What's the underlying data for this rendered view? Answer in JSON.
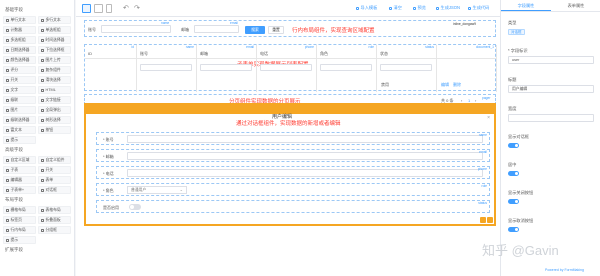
{
  "palette": {
    "basic_title": "基础字段",
    "basic": [
      [
        "单行文本",
        "多行文本"
      ],
      [
        "计数器",
        "单选框组"
      ],
      [
        "多选框组",
        "时间选择器"
      ],
      [
        "日期选择器",
        "下拉选择框"
      ],
      [
        "颜色选择器",
        "图片上传"
      ],
      [
        "评分",
        "复杂组件"
      ],
      [
        "开关",
        "滑块选择"
      ],
      [
        "文字",
        "HTML"
      ],
      [
        "级联",
        "文字链接"
      ],
      [
        "图片",
        "全局弹出"
      ],
      [
        "级联选择器",
        "树形选择"
      ],
      [
        "富文本",
        "按钮"
      ],
      [
        "提示"
      ]
    ],
    "advanced_title": "高级字段",
    "advanced": [
      [
        "自定义区域",
        "自定义组件"
      ],
      [
        "子表",
        "开关"
      ],
      [
        "编辑器",
        "表单"
      ],
      [
        "子表单+",
        "对话框"
      ]
    ],
    "layout_title": "布局字段",
    "layout": [
      [
        "栅格布局",
        "表格布局"
      ],
      [
        "标签页",
        "折叠面板"
      ],
      [
        "行内布局",
        "分组框"
      ],
      [
        "提示"
      ]
    ],
    "bottom_title": "扩展字段"
  },
  "toolbar": {
    "actions": [
      "导入模板",
      "清空",
      "预览",
      "生成JSON",
      "生成代码"
    ]
  },
  "canvas": {
    "form_row": {
      "field1_label": "账号",
      "field1_tag": "name",
      "field2_label": "邮箱",
      "field2_tag": "email",
      "search": "搜索",
      "reset": "重置",
      "field_tag3": "inline_dongaw9",
      "note": "行内布局组件，实现查询区域配置"
    },
    "subtable": {
      "cols": [
        {
          "head": "ID",
          "tag": "id"
        },
        {
          "head": "账号",
          "tag": "name"
        },
        {
          "head": "邮箱",
          "tag": "email"
        },
        {
          "head": "电话",
          "tag": "phone"
        },
        {
          "head": "角色",
          "tag": "role"
        },
        {
          "head": "状态",
          "tag": "status"
        },
        {
          "head": "",
          "tag": "document_1"
        }
      ],
      "status_val": "禁用",
      "edit": "编辑",
      "delete": "删除",
      "note": "子表单实现数据展示列表配置"
    },
    "pager": {
      "note": "分页组件实现数据的分页展示",
      "total": "共 0 条",
      "page": "1",
      "tag": "pager"
    },
    "dialog": {
      "title": "用户编辑",
      "note": "通过对话框组件，实现数据的新增或者编辑",
      "rows": [
        {
          "label": "* 账号",
          "tag": "name"
        },
        {
          "label": "* 邮箱",
          "tag": "email"
        },
        {
          "label": "* 电话",
          "tag": "phone"
        },
        {
          "label": "* 角色",
          "tag": "role",
          "select": "普通用户"
        },
        {
          "label": "是否启用",
          "tag": "status"
        }
      ]
    }
  },
  "right": {
    "tabs": [
      "字段属性",
      "表单属性"
    ],
    "type_label": "类型",
    "type_value": "对话框",
    "field_label": "* 字段标识",
    "field_value": "user",
    "title_label": "标题",
    "title_value": "用户编辑",
    "width_label": "宽度",
    "show_label": "显示对话框",
    "center_label": "居中",
    "close_label": "显示关闭按钮",
    "footer_label": "显示取消按钮",
    "footer_text": "Powered by FormMaking"
  },
  "watermark": "知乎 @Gavin"
}
